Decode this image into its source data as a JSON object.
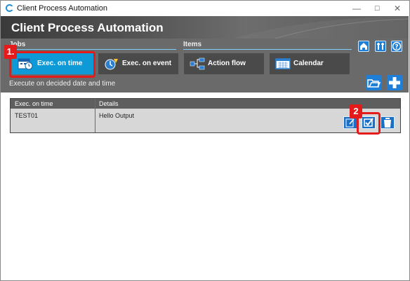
{
  "window": {
    "title": "Client Process Automation",
    "minimize": "—",
    "maximize": "☐",
    "close": "✕"
  },
  "header": {
    "title": "Client Process Automation"
  },
  "panel": {
    "jobs_label": "Jobs",
    "items_label": "Items",
    "tiles": [
      {
        "label": "Exec. on time",
        "icon": "calendar-clock-icon",
        "active": true
      },
      {
        "label": "Exec. on event",
        "icon": "event-timer-icon",
        "active": false
      },
      {
        "label": "Action flow",
        "icon": "flow-icon",
        "active": false
      },
      {
        "label": "Calendar",
        "icon": "calendar-icon",
        "active": false
      }
    ],
    "top_icons": [
      "home-icon",
      "tools-icon",
      "help-icon"
    ],
    "description": "Execute on decided date and time",
    "action_icons": [
      "open-folder-icon",
      "add-icon"
    ]
  },
  "annotations": {
    "badge1": "1.",
    "badge2": "2",
    "color": "#e51a1a"
  },
  "table": {
    "headers": [
      "Exec. on time",
      "Details"
    ],
    "rows": [
      {
        "exec_on_time": "TEST01",
        "details": "Hello Output",
        "actions": [
          "edit-icon",
          "checkbox-icon",
          "delete-icon"
        ]
      }
    ]
  },
  "colors": {
    "accent": "#0e9ad6",
    "panel": "#6a6a6a",
    "tile": "#4a4a4a",
    "icon_blue": "#1f7fd6"
  }
}
